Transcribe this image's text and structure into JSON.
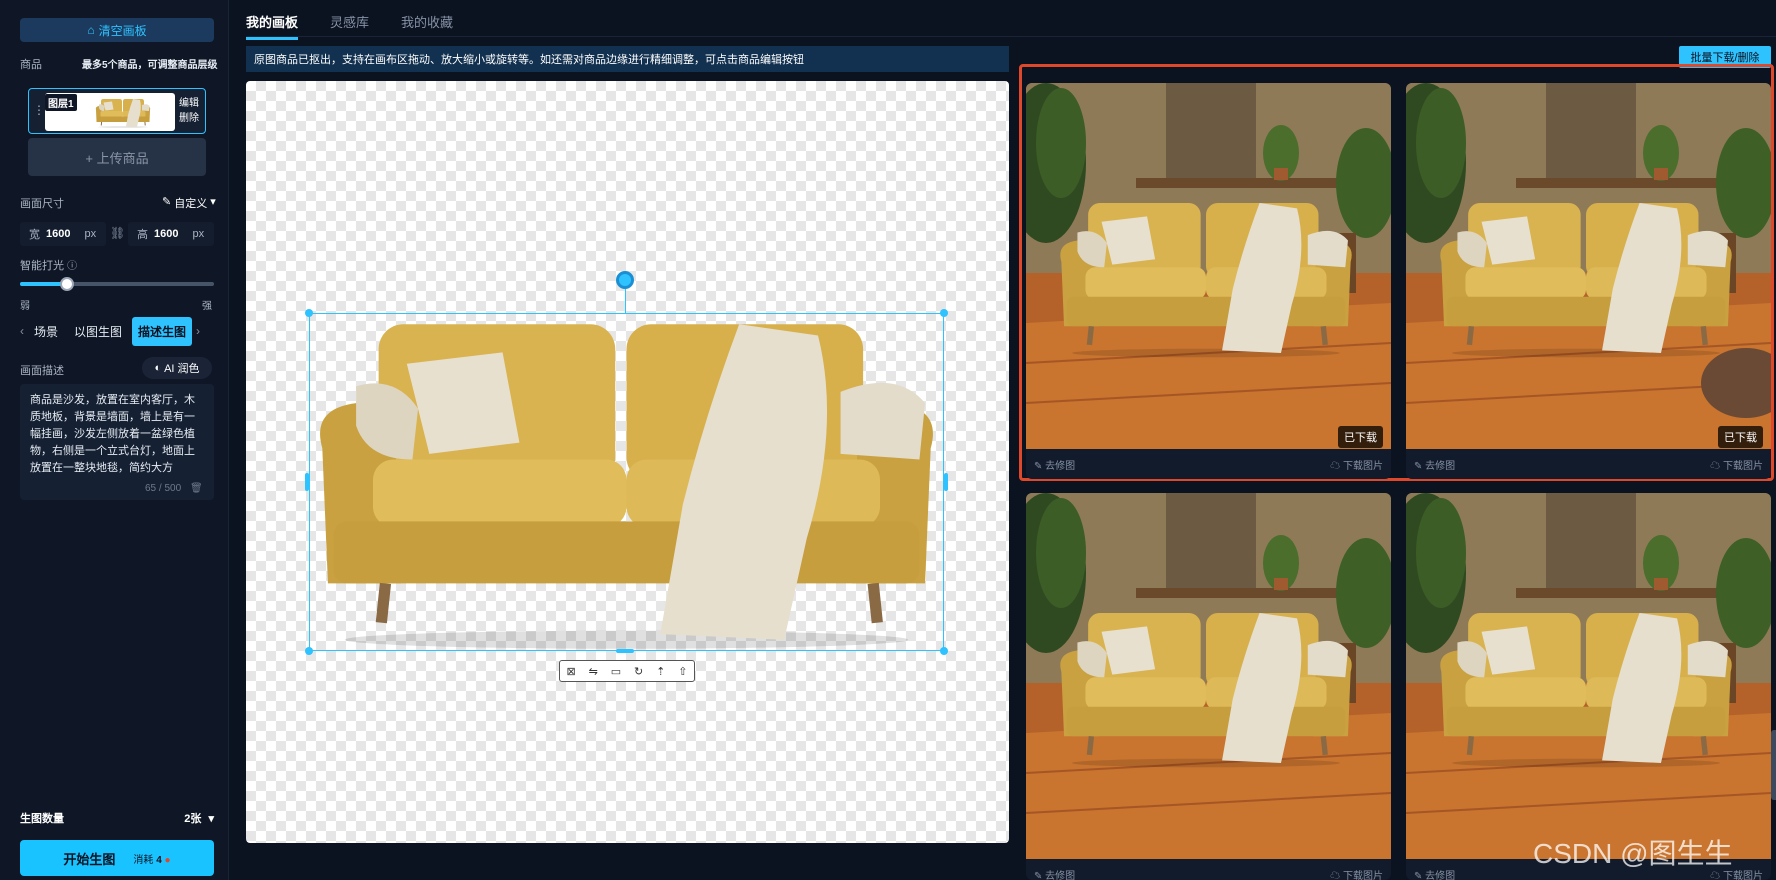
{
  "sidebar": {
    "clear_button": "清空画板",
    "products_label": "商品",
    "products_hint": "最多5个商品，可调整商品层级",
    "layer_tag": "图层1",
    "edit_label": "编辑",
    "delete_label": "删除",
    "upload_button": "+ 上传商品",
    "size_label": "画面尺寸",
    "custom_label": "自定义",
    "width_label": "宽",
    "width_value": "1600",
    "width_unit": "px",
    "height_label": "高",
    "height_value": "1600",
    "height_unit": "px",
    "lighting_label": "智能打光",
    "lighting_level": 0.24,
    "weak_label": "弱",
    "strong_label": "强",
    "modes": [
      "场景",
      "以图生图",
      "描述生图"
    ],
    "active_mode": "描述生图",
    "desc_label": "画面描述",
    "ai_button": "AI 润色",
    "description": "商品是沙发，放置在室内客厅，木质地板，背景是墙面，墙上是有一幅挂画，沙发左侧放着一盆绿色植物，右侧是一个立式台灯，地面上放置在一整块地毯，简约大方",
    "desc_count": "65 / 500",
    "qty_label": "生图数量",
    "qty_value": "2张",
    "start_button": "开始生图",
    "cost_label": "消耗",
    "cost_value": "4"
  },
  "main": {
    "tabs": [
      "我的画板",
      "灵感库",
      "我的收藏"
    ],
    "active_tab": "我的画板",
    "notice": "原图商品已抠出，支持在画布区拖动、放大缩小或旋转等。如还需对商品边缘进行精细调整，可点击商品编辑按钮"
  },
  "results": {
    "batch_button": "批量下载/删除",
    "downloaded_badge": "已下载",
    "retouch_label": "去修图",
    "download_label": "下载图片",
    "cards": [
      {
        "downloaded": true
      },
      {
        "downloaded": true
      },
      {
        "downloaded": false
      },
      {
        "downloaded": false
      }
    ]
  },
  "watermark": "CSDN @图生生",
  "colors": {
    "accent": "#2ec2ff",
    "frame": "#e0482c",
    "bg": "#0b1220"
  }
}
